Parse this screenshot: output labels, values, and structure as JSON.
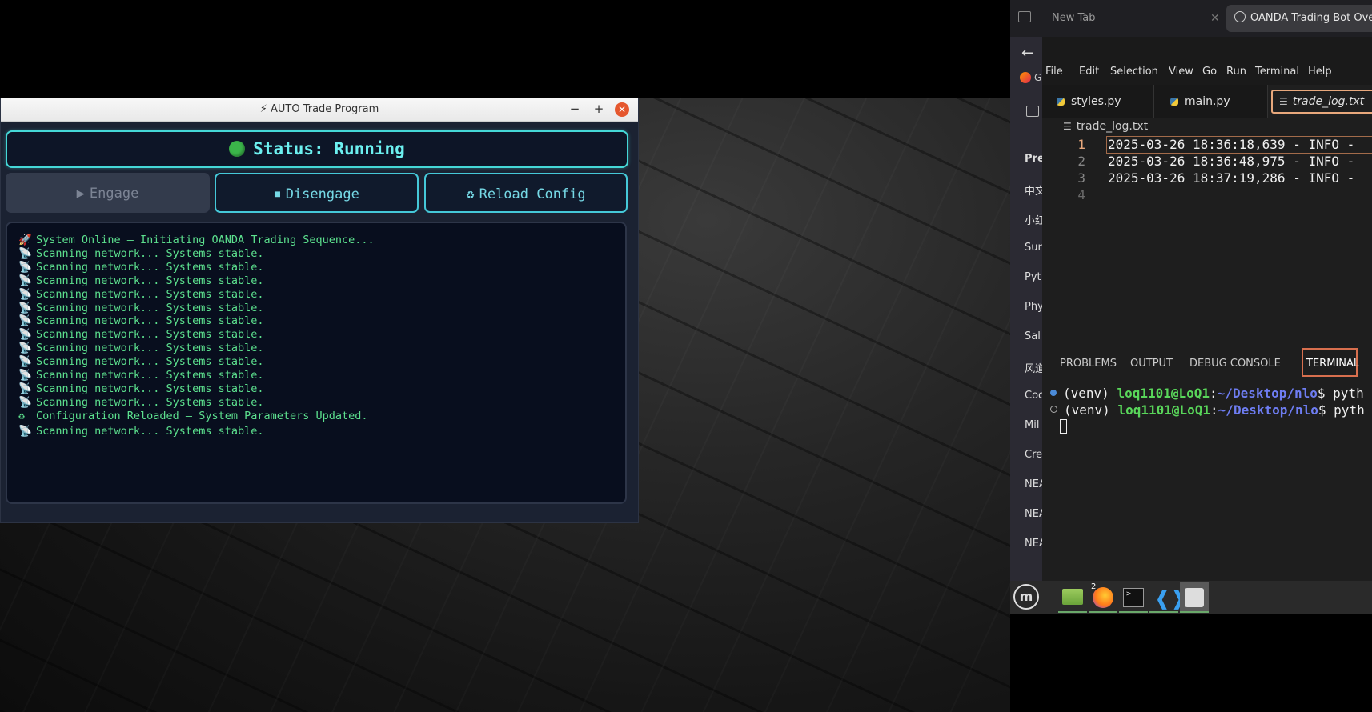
{
  "app": {
    "title": "⚡ AUTO Trade Program",
    "window_controls": {
      "minimize": "−",
      "maximize": "+",
      "close": "✕"
    },
    "status": {
      "label": "Status: Running",
      "dot_color": "#3bb54a"
    },
    "buttons": {
      "engage": {
        "icon": "▶",
        "label": "Engage",
        "state": "disabled"
      },
      "disengage": {
        "icon": "⏹",
        "label": "Disengage"
      },
      "reload": {
        "icon": "♻",
        "label": "Reload Config"
      }
    },
    "log": [
      {
        "icon": "🚀",
        "text": "System Online — Initiating OANDA Trading Sequence..."
      },
      {
        "icon": "📡",
        "text": "Scanning network... Systems stable."
      },
      {
        "icon": "📡",
        "text": "Scanning network... Systems stable."
      },
      {
        "icon": "📡",
        "text": "Scanning network... Systems stable."
      },
      {
        "icon": "📡",
        "text": "Scanning network... Systems stable."
      },
      {
        "icon": "📡",
        "text": "Scanning network... Systems stable."
      },
      {
        "icon": "📡",
        "text": "Scanning network... Systems stable."
      },
      {
        "icon": "📡",
        "text": "Scanning network... Systems stable."
      },
      {
        "icon": "📡",
        "text": "Scanning network... Systems stable."
      },
      {
        "icon": "📡",
        "text": "Scanning network... Systems stable."
      },
      {
        "icon": "📡",
        "text": "Scanning network... Systems stable."
      },
      {
        "icon": "📡",
        "text": "Scanning network... Systems stable."
      },
      {
        "icon": "📡",
        "text": "Scanning network... Systems stable."
      },
      {
        "icon": "♻",
        "text": "Configuration Reloaded — System Parameters Updated."
      },
      {
        "icon": "📡",
        "text": "Scanning network... Systems stable."
      }
    ],
    "colors": {
      "accent": "#45d8d8",
      "log_text": "#5ce08e",
      "background": "#1b2232"
    }
  },
  "browser": {
    "tabs": [
      {
        "label": "New Tab",
        "close": "✕"
      },
      {
        "label": "OANDA Trading Bot Over"
      }
    ],
    "back": "←",
    "bookmark_partial": "G",
    "bookmarks": [
      "Pre",
      "中文",
      "小红",
      "Sur",
      "Pyt",
      "Phy",
      "Sal",
      "风道",
      "Coo",
      "Mil",
      "Cre",
      "NEA",
      "NEA",
      "NEA"
    ]
  },
  "vscode": {
    "menu": [
      "File",
      "Edit",
      "Selection",
      "View",
      "Go",
      "Run",
      "Terminal",
      "Help"
    ],
    "tabs": [
      {
        "label": "styles.py",
        "icon": "python-icon"
      },
      {
        "label": "main.py",
        "icon": "python-icon"
      },
      {
        "label": "trade_log.txt",
        "icon": "text-file-icon",
        "active": true
      }
    ],
    "breadcrumb": "trade_log.txt",
    "lines": [
      {
        "num": "1",
        "text": "2025-03-26 18:36:18,639 - INFO - "
      },
      {
        "num": "2",
        "text": "2025-03-26 18:36:48,975 - INFO - "
      },
      {
        "num": "3",
        "text": "2025-03-26 18:37:19,286 - INFO - "
      },
      {
        "num": "4",
        "text": ""
      }
    ],
    "panel_tabs": [
      "PROBLEMS",
      "OUTPUT",
      "DEBUG CONSOLE",
      "TERMINAL"
    ],
    "terminal": [
      {
        "prefix": "(venv) ",
        "user": "loq1101@LoQ1",
        "sep": ":",
        "path": "~/Desktop/nlo",
        "cmd": "$ pyth"
      },
      {
        "prefix": "(venv) ",
        "user": "loq1101@LoQ1",
        "sep": ":",
        "path": "~/Desktop/nlo",
        "cmd": "$ pyth"
      }
    ]
  },
  "taskbar": {
    "apps": [
      "files-icon",
      "firefox-icon",
      "terminal-icon",
      "vscode-icon",
      "app-grid-icon"
    ],
    "firefox_badge": "2"
  }
}
